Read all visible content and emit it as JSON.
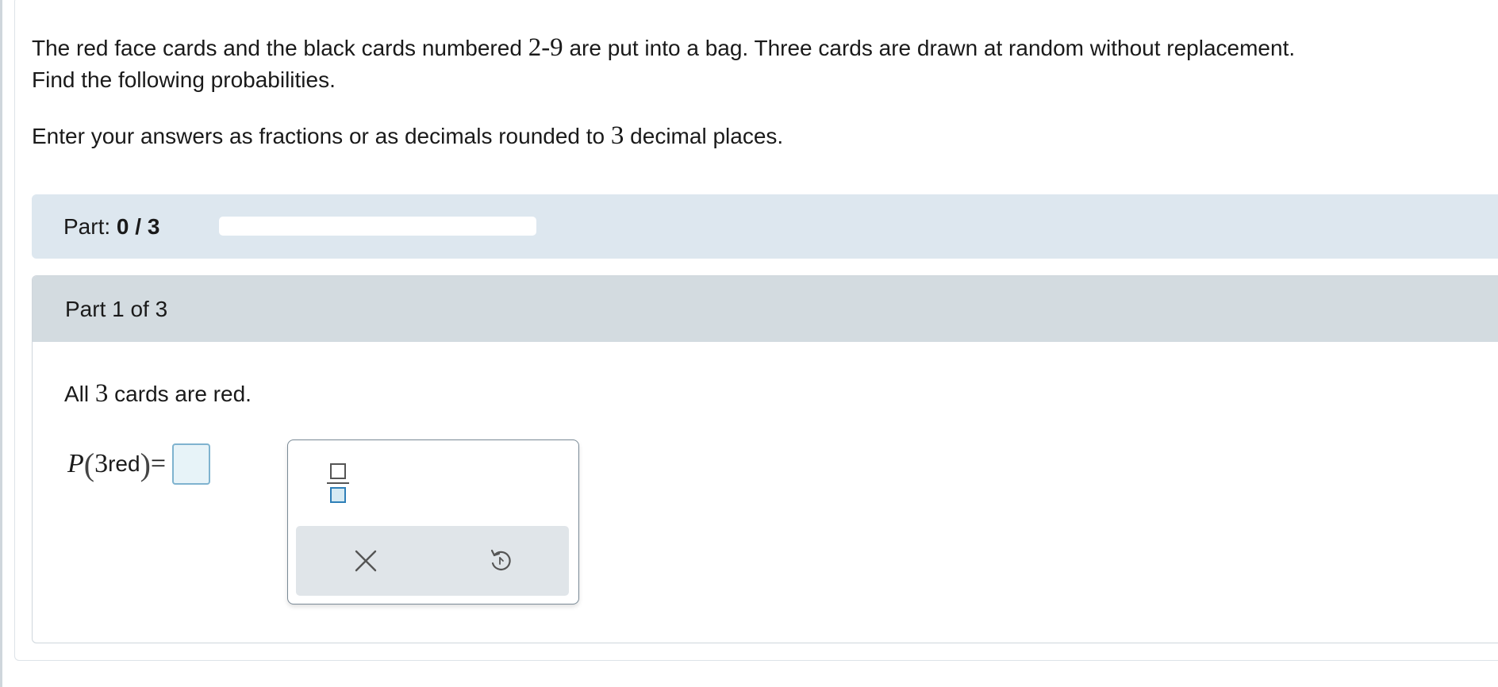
{
  "problem": {
    "line1_pre": "The red face cards and the black cards numbered ",
    "line1_num": "2-9",
    "line1_post": " are put into a bag. Three cards are drawn at random without replacement.",
    "line2": "Find the following probabilities.",
    "instr_pre": "Enter your answers as fractions or as decimals rounded to ",
    "instr_num": "3",
    "instr_post": " decimal places."
  },
  "progress": {
    "label": "Part: ",
    "value": "0 / 3",
    "fraction_complete": 0
  },
  "part": {
    "title": "Part 1 of 3",
    "question_pre": "All ",
    "question_num": "3",
    "question_post": " cards are red.",
    "answer": {
      "P": "P",
      "open_paren": "(",
      "num": "3",
      "word": " red",
      "close_paren": ")",
      "equals": "=",
      "value": ""
    }
  },
  "toolbox": {
    "tools": [
      "fraction-icon"
    ],
    "actions": [
      "clear-icon",
      "undo-icon"
    ]
  },
  "colors": {
    "progress_band": "#dde7ef",
    "part_header": "#d3dbe0",
    "answer_box_border": "#7fb3cf",
    "answer_box_fill": "#e7f3f8",
    "tool_accent": "#2f7fb8"
  }
}
